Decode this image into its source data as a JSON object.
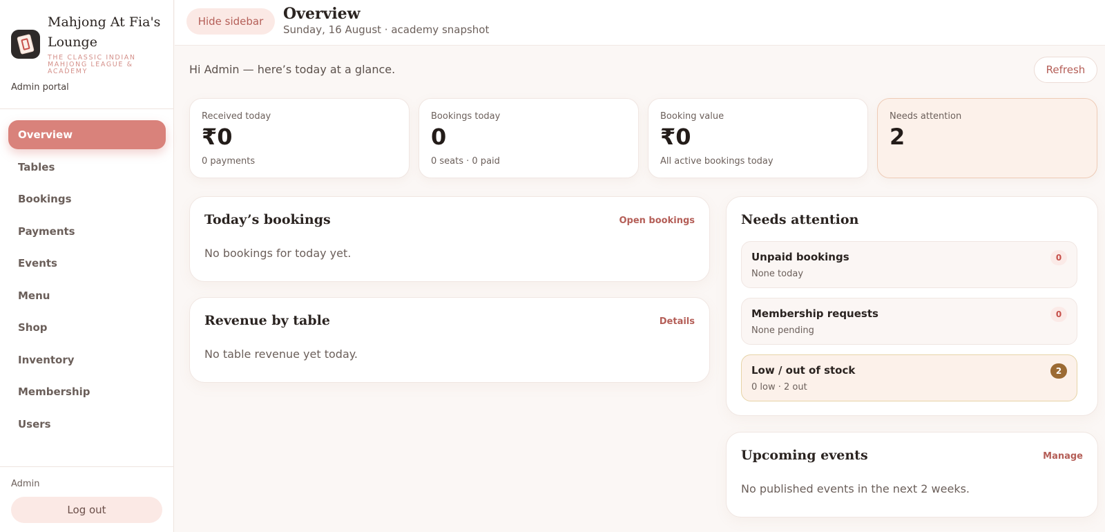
{
  "sidebar": {
    "brand_name": "Mahjong At Fia's Lounge",
    "brand_tagline": "THE CLASSIC INDIAN MAHJONG LEAGUE & ACADEMY",
    "portal_label": "Admin portal",
    "nav": [
      {
        "label": "Overview",
        "active": true
      },
      {
        "label": "Tables"
      },
      {
        "label": "Bookings"
      },
      {
        "label": "Payments"
      },
      {
        "label": "Events"
      },
      {
        "label": "Menu"
      },
      {
        "label": "Shop"
      },
      {
        "label": "Inventory"
      },
      {
        "label": "Membership"
      },
      {
        "label": "Users"
      }
    ],
    "user_label": "Admin",
    "logout_label": "Log out",
    "logo_icon": "mahjong-tile-icon"
  },
  "header": {
    "hide_sidebar_label": "Hide sidebar",
    "title": "Overview",
    "subtitle": "Sunday, 16 August · academy snapshot"
  },
  "main": {
    "greeting": "Hi Admin — here’s today at a glance.",
    "refresh_label": "Refresh",
    "stats": [
      {
        "label": "Received today",
        "value": "₹0",
        "sub": "0 payments"
      },
      {
        "label": "Bookings today",
        "value": "0",
        "sub": "0 seats · 0 paid"
      },
      {
        "label": "Booking value",
        "value": "₹0",
        "sub": "All active bookings today"
      },
      {
        "label": "Needs attention",
        "value": "2",
        "sub": ""
      }
    ],
    "todays_bookings": {
      "title": "Today’s bookings",
      "link": "Open bookings",
      "empty": "No bookings for today yet."
    },
    "revenue_by_table": {
      "title": "Revenue by table",
      "link": "Details",
      "empty": "No table revenue yet today."
    },
    "needs_attention": {
      "title": "Needs attention",
      "items": [
        {
          "title": "Unpaid bookings",
          "sub": "None today",
          "count": "0"
        },
        {
          "title": "Membership requests",
          "sub": "None pending",
          "count": "0"
        },
        {
          "title": "Low / out of stock",
          "sub": "0 low · 2 out",
          "count": "2"
        }
      ]
    },
    "upcoming_events": {
      "title": "Upcoming events",
      "link": "Manage",
      "empty": "No published events in the next 2 weeks."
    }
  },
  "colors": {
    "accent": "#d9827b",
    "accent_text": "#b45e57",
    "warn_badge": "#9b6a33",
    "page_bg": "#fbf7f5"
  }
}
